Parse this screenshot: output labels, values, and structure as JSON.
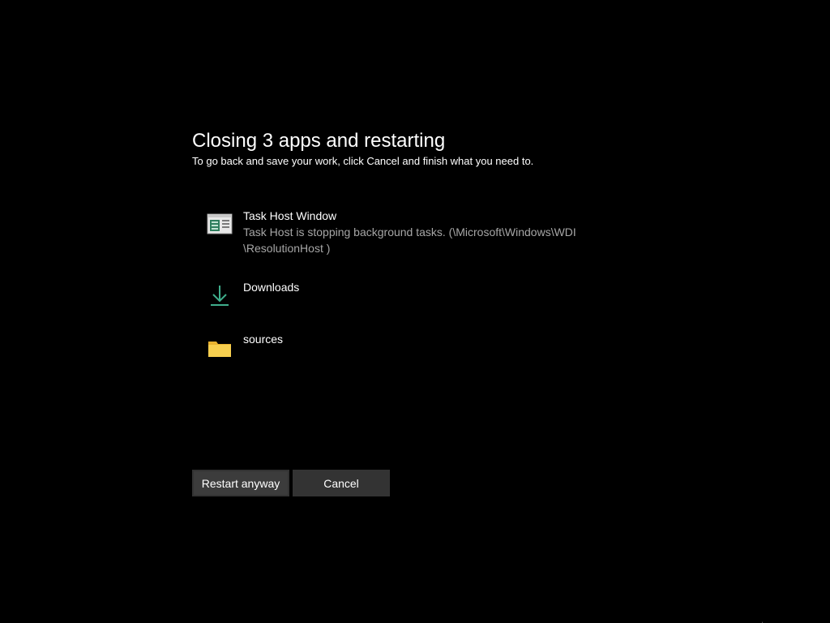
{
  "dialog": {
    "title": "Closing 3 apps and restarting",
    "subtitle": "To go back and save your work, click Cancel and finish what you need to."
  },
  "apps": [
    {
      "name": "Task Host Window",
      "description_line1": "Task Host is stopping background tasks. (\\Microsoft\\Windows\\WDI",
      "description_line2": "\\ResolutionHost )",
      "icon": "task-host-window-icon"
    },
    {
      "name": "Downloads",
      "icon": "download-arrow-icon"
    },
    {
      "name": "sources",
      "icon": "folder-icon"
    }
  ],
  "buttons": {
    "restart_label": "Restart anyway",
    "cancel_label": "Cancel"
  },
  "colors": {
    "background": "#000000",
    "text_primary": "#ffffff",
    "text_secondary": "#a6a6a6",
    "button_bg": "#333333",
    "download_icon": "#3fae8c",
    "folder_icon": "#f7cf4f"
  }
}
